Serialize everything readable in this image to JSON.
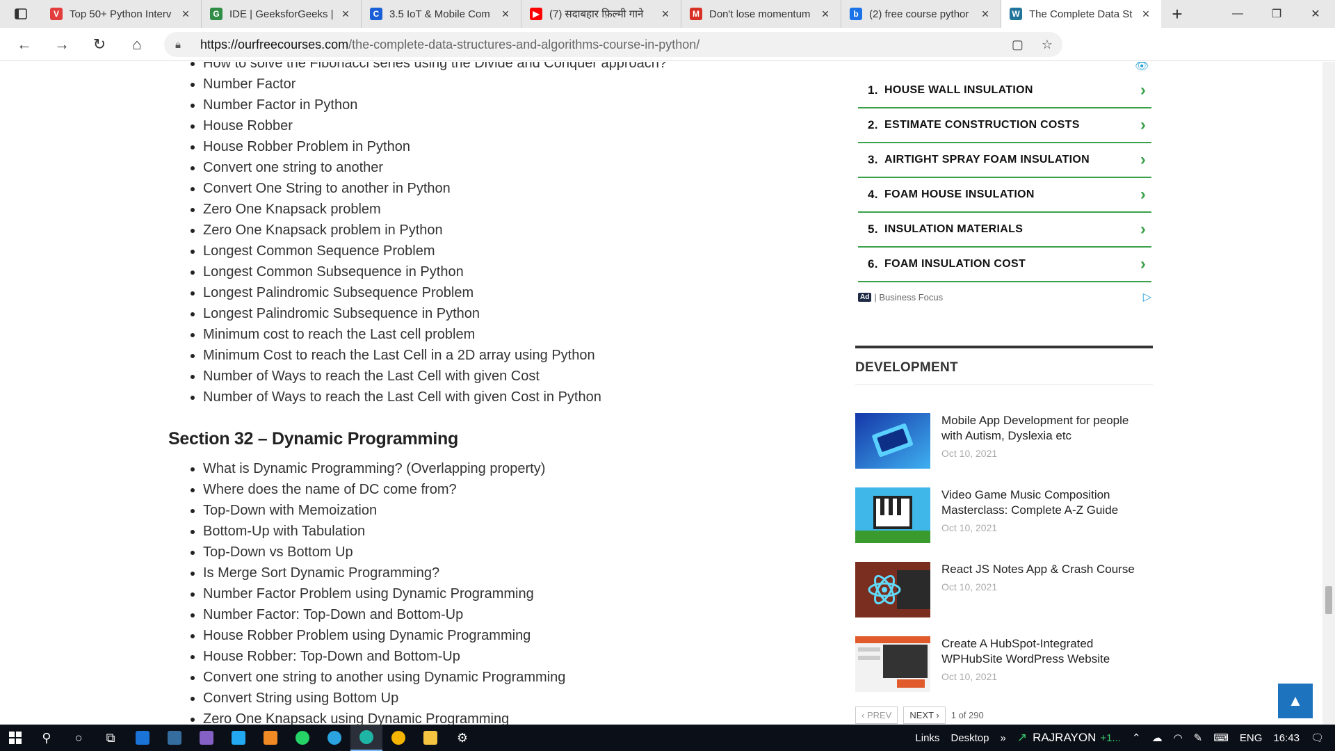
{
  "browser": {
    "tabs": [
      {
        "title": "Top 50+ Python Interv",
        "fav": "V",
        "favcolor": "#e23c3c"
      },
      {
        "title": "IDE | GeeksforGeeks |",
        "fav": "G",
        "favcolor": "#2f8d46"
      },
      {
        "title": "3.5 IoT & Mobile Com",
        "fav": "C",
        "favcolor": "#1a5fd6"
      },
      {
        "title": "(7) सदाबहार फ़िल्मी गाने",
        "fav": "▶",
        "favcolor": "#ff0000"
      },
      {
        "title": "Don't lose momentum",
        "fav": "M",
        "favcolor": "#d93025"
      },
      {
        "title": "(2) free course pythor",
        "fav": "b",
        "favcolor": "#1a73e8"
      },
      {
        "title": "The Complete Data St",
        "fav": "W",
        "favcolor": "#21759b"
      }
    ],
    "url_host": "https://ourfreecourses.com",
    "url_path": "/the-complete-data-structures-and-algorithms-course-in-python/"
  },
  "main": {
    "top_items": [
      "How to solve the Fibonacci series using the Divide and Conquer approach?",
      "Number Factor",
      "Number Factor in Python",
      "House Robber",
      "House Robber Problem in Python",
      "Convert one string to another",
      "Convert One String to another in Python",
      "Zero One Knapsack problem",
      "Zero One Knapsack problem in Python",
      "Longest Common Sequence Problem",
      "Longest Common Subsequence in Python",
      "Longest Palindromic Subsequence Problem",
      "Longest Palindromic Subsequence in Python",
      "Minimum cost to reach the Last cell problem",
      "Minimum Cost to reach the Last Cell in a 2D array using Python",
      "Number of Ways to reach the Last Cell with given Cost",
      "Number of Ways to reach the Last Cell with given Cost in Python"
    ],
    "section_title": "Section 32 – Dynamic Programming",
    "section_items": [
      "What is Dynamic Programming? (Overlapping property)",
      "Where does the name of DC come from?",
      "Top-Down with Memoization",
      "Bottom-Up with Tabulation",
      "Top-Down vs Bottom Up",
      "Is Merge Sort Dynamic Programming?",
      "Number Factor Problem using Dynamic Programming",
      "Number Factor: Top-Down and Bottom-Up",
      "House Robber Problem using Dynamic Programming",
      "House Robber: Top-Down and Bottom-Up",
      "Convert one string to another using Dynamic Programming",
      "Convert String using Bottom Up",
      "Zero One Knapsack using Dynamic Programming"
    ]
  },
  "ad": {
    "items": [
      {
        "num": "1.",
        "label": "HOUSE WALL INSULATION"
      },
      {
        "num": "2.",
        "label": "ESTIMATE CONSTRUCTION COSTS"
      },
      {
        "num": "3.",
        "label": "AIRTIGHT SPRAY FOAM INSULATION"
      },
      {
        "num": "4.",
        "label": "FOAM HOUSE INSULATION"
      },
      {
        "num": "5.",
        "label": "INSULATION MATERIALS"
      },
      {
        "num": "6.",
        "label": "FOAM INSULATION COST"
      }
    ],
    "badge": "Ad",
    "source": "| Business Focus"
  },
  "sidebar": {
    "section_title": "DEVELOPMENT",
    "posts": [
      {
        "title": "Mobile App Development for people with Autism, Dyslexia etc",
        "date": "Oct 10, 2021"
      },
      {
        "title": "Video Game Music Composition Masterclass: Complete A-Z Guide",
        "date": "Oct 10, 2021"
      },
      {
        "title": "React JS Notes App & Crash Course",
        "date": "Oct 10, 2021"
      },
      {
        "title": "Create A HubSpot-Integrated WPHubSite WordPress Website",
        "date": "Oct 10, 2021"
      }
    ],
    "pager": {
      "prev": "‹ PREV",
      "next": "NEXT ›",
      "count": "1 of 290"
    }
  },
  "taskbar": {
    "links": "Links",
    "desktop": "Desktop",
    "stock": "RAJRAYON",
    "stock_change": "+1...",
    "lang": "ENG",
    "time": "16:43"
  },
  "colors": {
    "accent_green": "#3aa14a",
    "scroll_top_blue": "#1e73be"
  }
}
